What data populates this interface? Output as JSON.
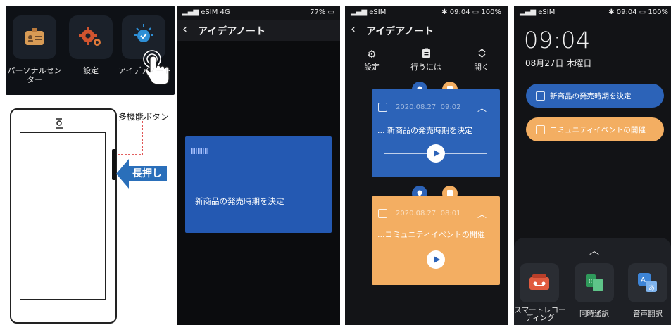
{
  "panel1": {
    "apps": [
      {
        "label": "パーソナルセン\nター",
        "icon": "id-card-icon"
      },
      {
        "label": "設定",
        "icon": "gears-icon"
      },
      {
        "label": "アイデアノート",
        "icon": "lightbulb-icon"
      }
    ],
    "callout_label": "多機能ボタン",
    "press_label": "長押し"
  },
  "panel2": {
    "status_left": "eSIM 4G",
    "status_right": "77%",
    "title": "アイデアノート",
    "recording_text": "新商品の発売時期を決定"
  },
  "panel3": {
    "status_left": "eSIM",
    "status_right": "09:04",
    "status_battery": "100%",
    "title": "アイデアノート",
    "toolbar": [
      {
        "label": "設定",
        "icon": "gear-icon"
      },
      {
        "label": "行うには",
        "icon": "clipboard-icon"
      },
      {
        "label": "開く",
        "icon": "expand-icon"
      }
    ],
    "notes": [
      {
        "date": "2020.08.27",
        "time": "09:02",
        "text": "... 新商品の発売時期を決定",
        "color": "#2c63b8"
      },
      {
        "date": "2020.08.27",
        "time": "08:01",
        "text": "...コミュニティイベントの開催",
        "color": "#f3ae62"
      }
    ]
  },
  "panel4": {
    "status_left": "eSIM",
    "status_right": "09:04",
    "status_battery": "100%",
    "clock": "09:04",
    "date": "08月27日 木曜日",
    "todos": [
      {
        "text": "新商品の発売時期を決定",
        "color": "#2c63b8"
      },
      {
        "text": "コミュニティイベントの開催",
        "color": "#f3ae62"
      }
    ],
    "dock": [
      {
        "label": "スマートレコー\nディング",
        "icon": "recorder-icon"
      },
      {
        "label": "同時通訳",
        "icon": "simultaneous-interpretation-icon"
      },
      {
        "label": "音声翻訳",
        "icon": "voice-translate-icon"
      }
    ]
  }
}
